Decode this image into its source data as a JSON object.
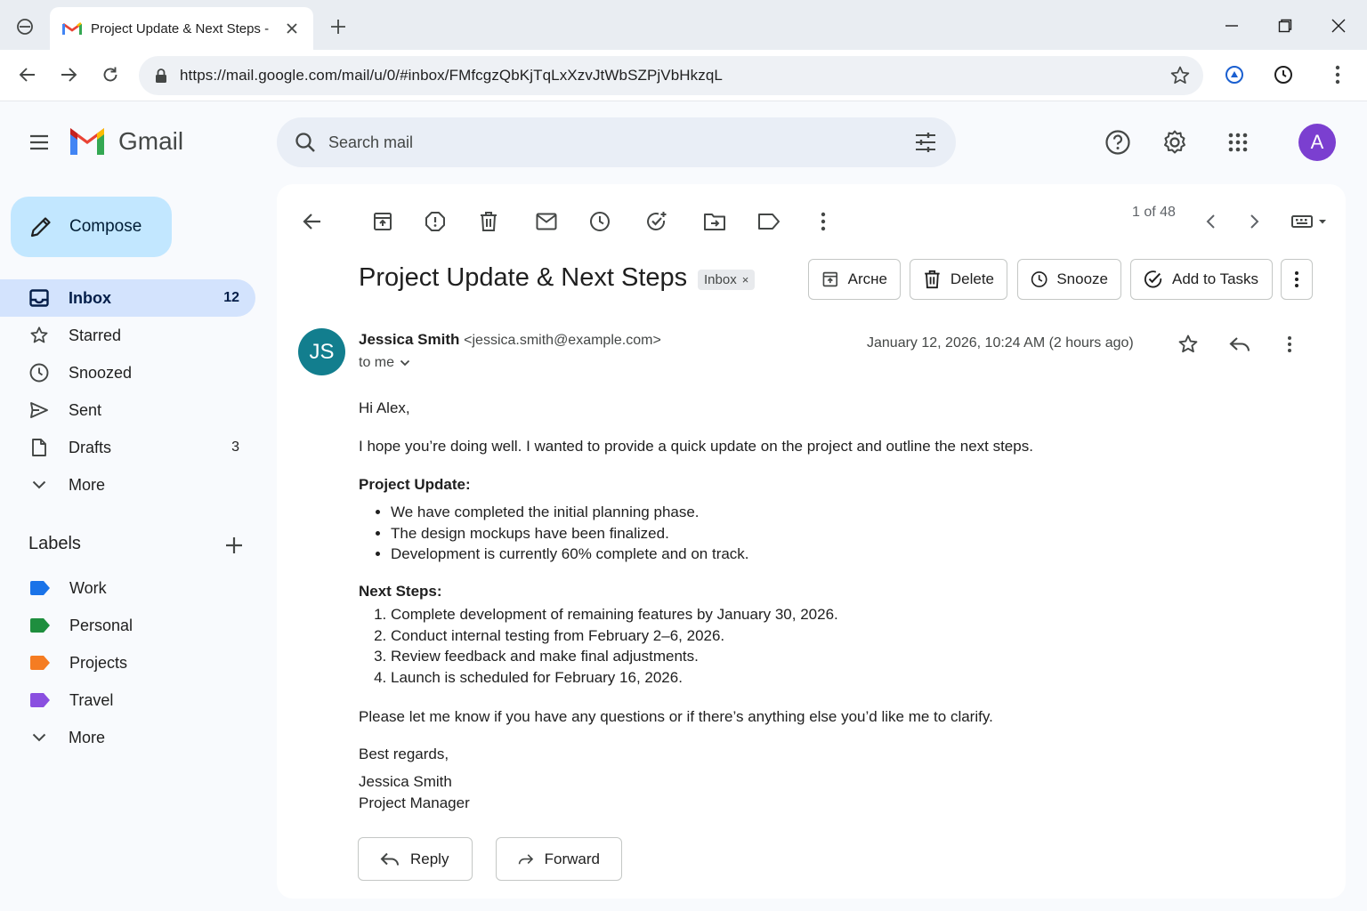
{
  "browser": {
    "tab_title": "Project Update & Next Steps -",
    "url": "https://mail.google.com/mail/u/0/#inbox/FMfcgzQbKjTqLxXzvJtWbSZPjVbHkzqL"
  },
  "header": {
    "app_name": "Gmail",
    "search_placeholder": "Search mail",
    "avatar_letter": "A"
  },
  "sidebar": {
    "compose_label": "Compose",
    "items": [
      {
        "label": "Inbox",
        "count": "12",
        "icon": "inbox-icon"
      },
      {
        "label": "Starred",
        "count": "",
        "icon": "star-icon"
      },
      {
        "label": "Snoozed",
        "count": "",
        "icon": "clock-icon"
      },
      {
        "label": "Sent",
        "count": "",
        "icon": "send-icon"
      },
      {
        "label": "Drafts",
        "count": "3",
        "icon": "draft-icon"
      },
      {
        "label": "More",
        "count": "",
        "icon": "chevron-down-icon"
      }
    ],
    "labels_header": "Labels",
    "labels": [
      {
        "label": "Work",
        "color": "#1a73e8"
      },
      {
        "label": "Personal",
        "color": "#1e8e3e"
      },
      {
        "label": "Projects",
        "color": "#f57c22"
      },
      {
        "label": "Travel",
        "color": "#8a4fe0"
      }
    ],
    "labels_more": "More"
  },
  "email": {
    "pager": "1 of 48",
    "subject": "Project Update & Next Steps",
    "chip": "Inbox",
    "chip_close": "×",
    "actions": {
      "archive": "Arcне",
      "delete": "Delete",
      "snooze": "Snooze",
      "tasks": "Add to Tasks"
    },
    "avatar_initials": "JS",
    "sender_name": "Jessica Smith",
    "sender_email": "<jessica.smith@example.com>",
    "to": "to me",
    "date": "January 12, 2026, 10:24 AM (2 hours ago)",
    "greeting": "Hi Alex,",
    "intro": "I hope you’re doing well. I wanted to provide a quick update on the project and outline the next steps.",
    "update_heading": "Project Update:",
    "update_items": [
      "We have completed the initial planning phase.",
      "The design mockups have been finalized.",
      "Development is currently 60% complete and on track."
    ],
    "steps_heading": "Next Steps:",
    "steps_items": [
      "Complete development of remaining features by January 30, 2026.",
      "Conduct internal testing from February 2–6, 2026.",
      "Review feedback and make final adjustments.",
      "Launch is scheduled for February 16, 2026."
    ],
    "closing": "Please let me know if you have any questions or if there’s anything else you’d like me to clarify.",
    "signoff": "Best regards,",
    "sig_name": "Jessica Smith",
    "sig_title": "Project Manager",
    "reply_label": "Reply",
    "forward_label": "Forward"
  }
}
